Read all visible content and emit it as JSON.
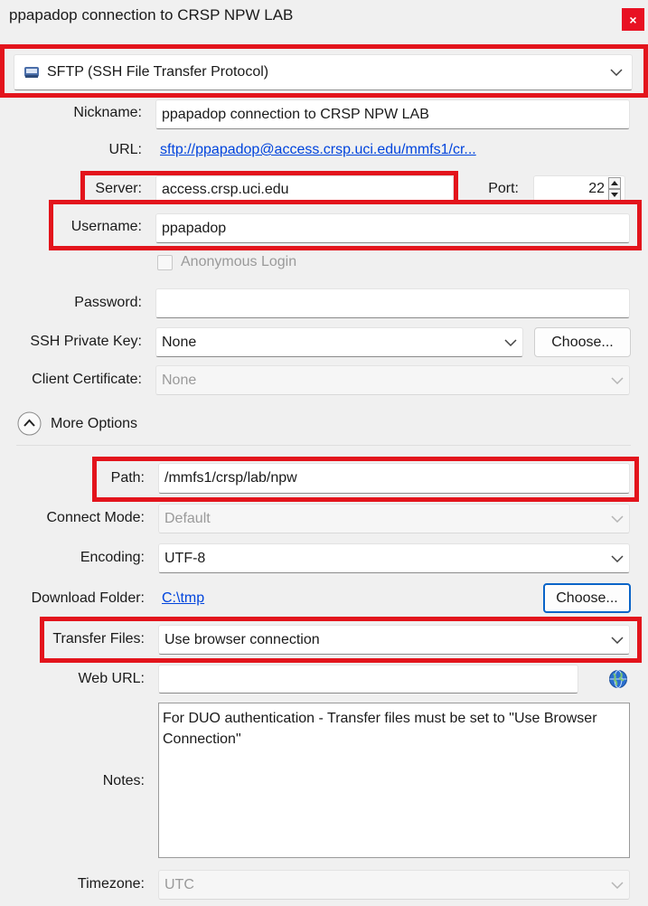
{
  "window": {
    "title": "ppapadop connection to CRSP NPW LAB",
    "close_glyph": "×"
  },
  "protocol": {
    "value": "SFTP (SSH File Transfer Protocol)",
    "icon": "sftp-protocol-icon"
  },
  "nickname": {
    "label": "Nickname:",
    "value": "ppapadop connection to CRSP NPW LAB"
  },
  "url": {
    "label": "URL:",
    "value": "sftp://ppapadop@access.crsp.uci.edu/mmfs1/cr..."
  },
  "server": {
    "label": "Server:",
    "value": "access.crsp.uci.edu"
  },
  "port": {
    "label": "Port:",
    "value": "22"
  },
  "username": {
    "label": "Username:",
    "value": "ppapadop"
  },
  "anonymous": {
    "label": "Anonymous Login",
    "checked": false
  },
  "password": {
    "label": "Password:",
    "value": ""
  },
  "ssh_key": {
    "label": "SSH Private Key:",
    "value": "None",
    "button": "Choose..."
  },
  "client_cert": {
    "label": "Client Certificate:",
    "value": "None"
  },
  "more_options": {
    "label": "More Options"
  },
  "path": {
    "label": "Path:",
    "value": "/mmfs1/crsp/lab/npw"
  },
  "connect_mode": {
    "label": "Connect Mode:",
    "value": "Default"
  },
  "encoding": {
    "label": "Encoding:",
    "value": "UTF-8"
  },
  "download_folder": {
    "label": "Download Folder:",
    "value": "C:\\tmp",
    "button": "Choose..."
  },
  "transfer_files": {
    "label": "Transfer Files:",
    "value": "Use browser connection"
  },
  "web_url": {
    "label": "Web URL:",
    "value": ""
  },
  "notes": {
    "label": "Notes:",
    "value": "For DUO authentication - Transfer files must be set to \"Use Browser Connection\""
  },
  "timezone": {
    "label": "Timezone:",
    "value": "UTC"
  },
  "colors": {
    "highlight": "#e3141c",
    "link": "#0044dd",
    "focus": "#0a64c8",
    "close": "#e81123"
  }
}
